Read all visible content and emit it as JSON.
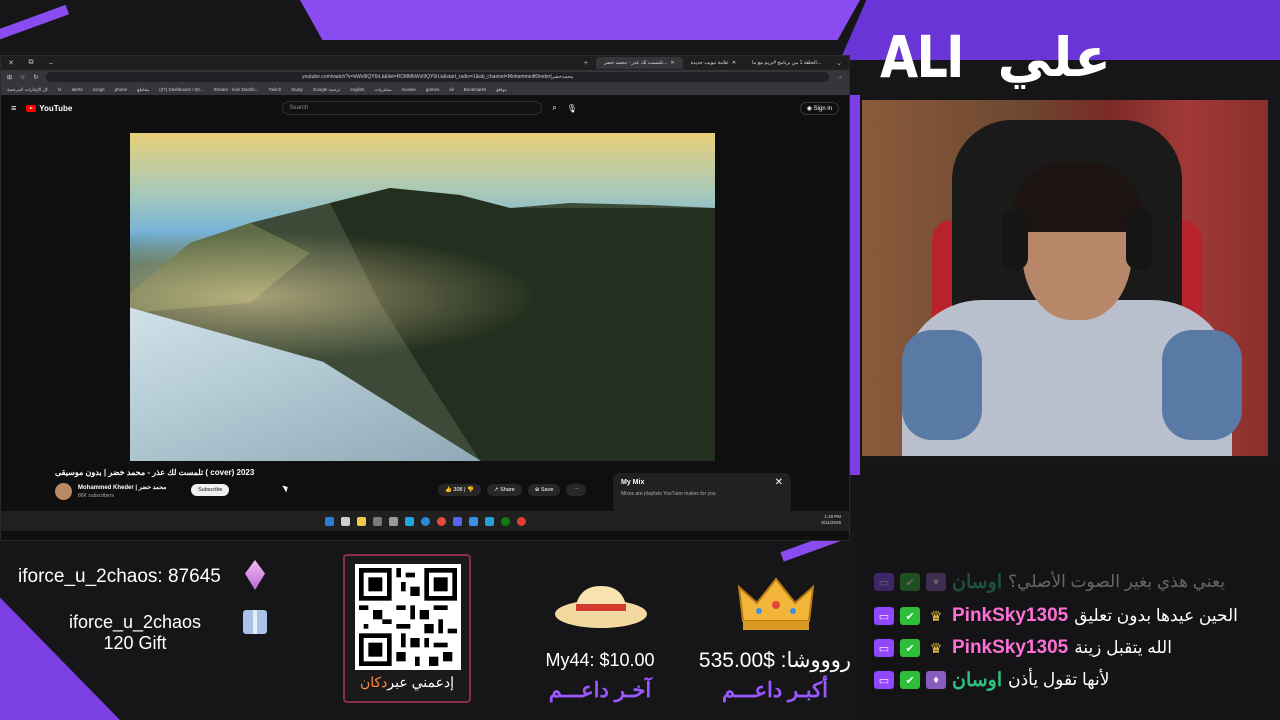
{
  "browser": {
    "tabs": [
      {
        "label": "الحلقة 1 من برنامج #بريم مع ما..."
      },
      {
        "label": "علامة تبويب جديدة"
      },
      {
        "label": "تلمست لك عذر - محمد خضر..."
      }
    ],
    "url": "youtube.com/watch?v=bWxl9QY6rLk&list=RDMMbWxl9QY6rLk&start_radio=1&ab_channel=MohammedKheder|محمدخضر",
    "bookmarks": [
      "fx",
      "alerts",
      "songs",
      "phone",
      "مقاطع",
      "(27) Dashboard / Str...",
      "Stream - Kick Dashb...",
      "Twitch",
      "Study",
      "Google ترجمة",
      "english",
      "مشتريات",
      "movies",
      "games",
      "all",
      "Bookmarks",
      "مواقع"
    ],
    "bookmarks_right": "كل الإشارات المرجعية"
  },
  "youtube": {
    "logo_text": "YouTube",
    "search_placeholder": "Search",
    "signin_label": "Sign in",
    "video_title": "تلمست لك عذر - محمد خضر | بدون موسيقى ( cover) 2023",
    "channel_name": "Mohammed Kheder | محمد خضر",
    "channel_subs": "86K subscribers",
    "subscribe_label": "Subscribe",
    "likes": "308",
    "share_label": "Share",
    "save_label": "Save",
    "mix_title": "My Mix",
    "mix_subtitle": "Mixes are playlists YouTube makes for you"
  },
  "taskbar": {
    "time": "1:18 PM",
    "date": "8/11/2025",
    "icon_colors": [
      "#2b7cd3",
      "#cfcfcf",
      "#f2c94c",
      "#7a7a7a",
      "#9a9a9a",
      "#1ea7e1",
      "#2b88d8",
      "#e04b3c",
      "#5865f2",
      "#3a8ee6",
      "#2aa0d8",
      "#107c10",
      "#e23b3b"
    ]
  },
  "overlay": {
    "logo_latin": "ALI",
    "logo_arabic": "علي",
    "alert_follow": "iforce_u_2chaos: 87645",
    "gift_user": "iforce_u_2chaos",
    "gift_text": "120 Gift",
    "qr_caption_prefix": "إدعمني عبر",
    "qr_caption_brand": "دكان",
    "last_supporter_value": "My44: $10.00",
    "last_supporter_label": "آخـر داعـــم",
    "top_supporter_value": "روووشا: $535.00",
    "top_supporter_label": "أكبـر داعـــم"
  },
  "chat": [
    {
      "user": "اوسان",
      "message": "يعني هذي بغير الصوت الأصلي؟",
      "color": "#2ec27e",
      "faded": true
    },
    {
      "user": "PinkSky1305",
      "message": "الحين عيدها بدون تعليق",
      "color": "#ff6fd8",
      "faded": false
    },
    {
      "user": "PinkSky1305",
      "message": "الله يتقبل زينة",
      "color": "#ff6fd8",
      "faded": false
    },
    {
      "user": "اوسان",
      "message": "لأنها تقول يأذن",
      "color": "#2ec27e",
      "faded": false
    }
  ]
}
